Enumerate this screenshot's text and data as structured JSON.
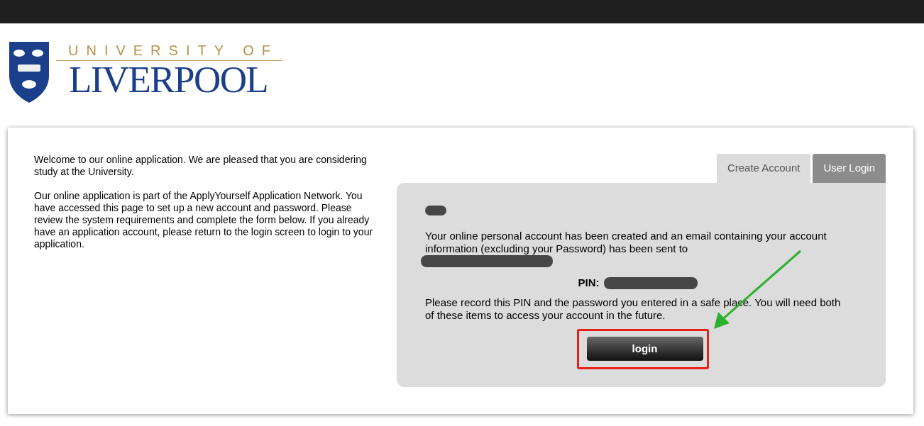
{
  "logo": {
    "line_1": "UNIVERSITY OF",
    "line_2": "LIVERPOOL"
  },
  "intro": [
    "Welcome to our online application. We are pleased that you are considering study at the University.",
    "Our online application is part of the ApplyYourself Application Network. You have accessed this page to set up a new account and password. Please review the system requirements and complete the form below. If you already have an application account, please return to the login screen to login to your application."
  ],
  "tabs": [
    {
      "label": "Create Account",
      "selected": true
    },
    {
      "label": "User Login",
      "selected": false
    }
  ],
  "panel": {
    "message": "Your online personal account has been created and an email containing your account information (excluding your Password) has been sent to",
    "pin_label": "PIN:",
    "notice": "Please record this PIN and the password you entered in a safe place. You will need both of these items to access your account in the future.",
    "button": "login"
  }
}
